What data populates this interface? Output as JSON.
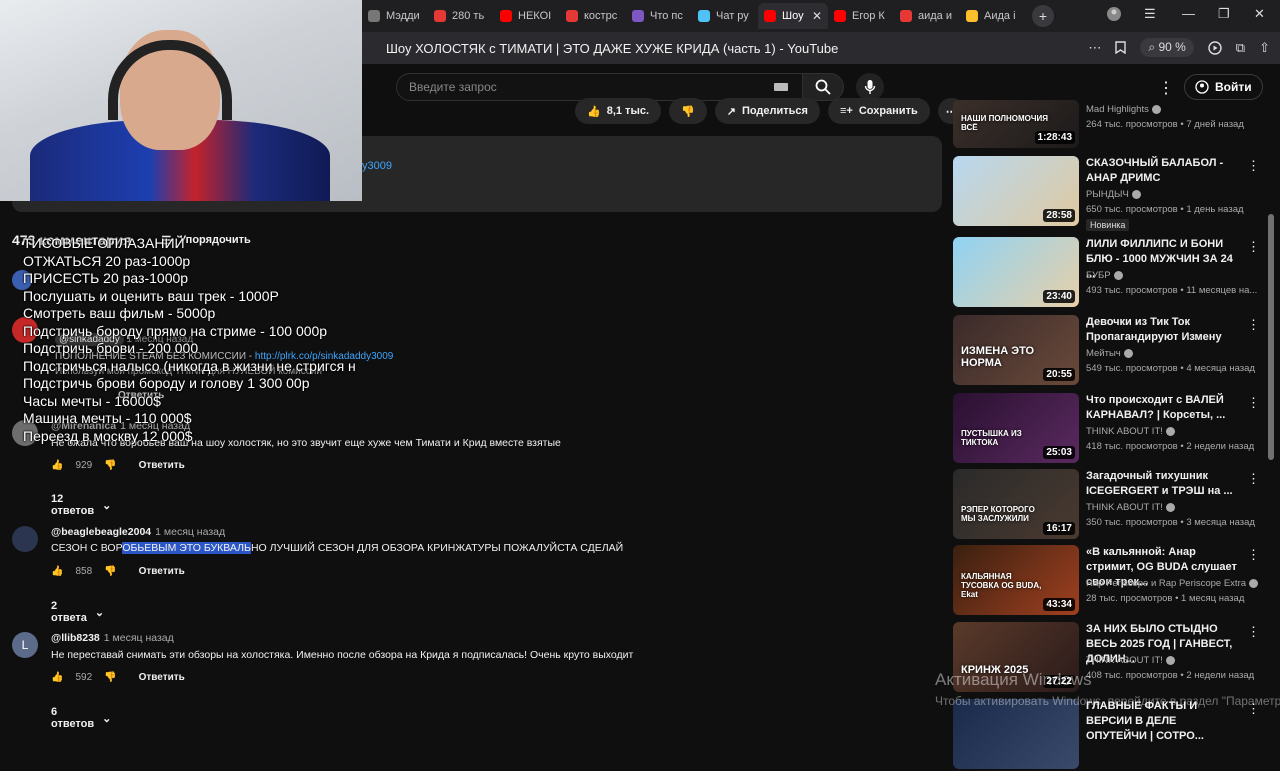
{
  "browser": {
    "tabs": [
      {
        "label": "Мэдди",
        "color": "#777777"
      },
      {
        "label": "280 ть",
        "color": "#e53935"
      },
      {
        "label": "НЕКОІ",
        "color": "#ff0000"
      },
      {
        "label": "кострс",
        "color": "#e53935"
      },
      {
        "label": "Что пс",
        "color": "#7e57c2"
      },
      {
        "label": "Чат ру",
        "color": "#4fc3f7"
      },
      {
        "label": "Шоу",
        "color": "#ff0000",
        "active": true
      },
      {
        "label": "Егор К",
        "color": "#ff0000"
      },
      {
        "label": "аида и",
        "color": "#e53935"
      },
      {
        "label": "Аида і",
        "color": "#fbc02d"
      }
    ],
    "page_title": "Шоу ХОЛОСТЯК с ТИМАТИ | ЭТО ДАЖЕ ХУЖЕ КРИДА (часть 1) - YouTube",
    "zoom": "90 %",
    "new_tab": "+"
  },
  "header": {
    "search_placeholder": "Введите запрос",
    "signin_label": "Войти"
  },
  "actions": {
    "likes": "8,1 тыс.",
    "share": "Поделиться",
    "save": "Сохранить"
  },
  "description": {
    "link": "y3009"
  },
  "comments": {
    "count": "473 комментария",
    "sort_label": "Упорядочить",
    "reply_label": "Ответить",
    "items": [
      {
        "author": "@Mirenanica",
        "time": "1 месяц назад",
        "text": "Не ожала что воробьев ваш на шоу холостяк, но это звучит еще хуже чем Тимати и Крид вместе взятые",
        "likes": "929",
        "replies": "12 ответов"
      },
      {
        "author": "@beaglebeagle2004",
        "time": "1 месяц назад",
        "text_before": "СЕЗОН С ВОР",
        "text_highlight": "ОБЬЕВЫМ ЭТО БУКВАЛЬ",
        "text_after": "НО ЛУЧШИЙ СЕЗОН ДЛЯ ОБЗОРА КРИНЖАТУРЫ ПОЖАЛУЙСТА СДЕЛАЙ",
        "likes": "858",
        "replies": "2 ответа"
      },
      {
        "author": "@llib8238",
        "time": "1 месяц назад",
        "avatar_letter": "L",
        "text": "Не переставай снимать эти обзоры на холостяка. Именно после обзора на Крида я подписалась! Очень круто выходит",
        "likes": "592",
        "replies": "6 ответов"
      }
    ],
    "pinned": {
      "author": "@sinkadaddy",
      "time": "1 месяц назад",
      "line1": "ПОПОЛНЕНИЕ STEAM БЕЗ КОМИССИИ -",
      "link": "http://plrk.co/p/sinkadaddy3009",
      "line2": "Используй мой промокод THINK для НУЛЕВОЙ комиссии",
      "reply": "Ответить"
    }
  },
  "overlay": {
    "lines": [
      "ТИСОВЫЕ ОПЛАЗАНИЙ",
      "ОТЖАТЬСЯ 20 раз-1000р",
      "ПРИСЕСТЬ 20 раз-1000р",
      "Послушать и оценить ваш трек - 1000Р",
      "Смотреть ваш фильм - 5000р",
      "Подстричь бороду прямо на стриме - 100 000р",
      "Подстричь брови - 200 000",
      "Подстричься налысо (никогда в жизни не стригся н",
      "Подстричь брови бороду и голову 1 300 00р",
      "Часы мечты - 16000$",
      "Машина мечты - 110 000$",
      "Переезд в москву 12 000$"
    ]
  },
  "sidebar": {
    "videos": [
      {
        "title": "",
        "channel": "Mad Highlights",
        "meta": "264 тыс. просмотров • 7 дней назад",
        "duration": "1:28:43",
        "thumb_text": "НАШИ ПОЛНОМОЧИЯ ВСЁ",
        "colors": [
          "#3b2f2a",
          "#1c1a1a"
        ]
      },
      {
        "title": "СКАЗОЧНЫЙ БАЛАБОЛ - АНАР ДРИМС",
        "channel": "РЫНДЫЧ",
        "meta": "650 тыс. просмотров • 1 день назад",
        "badge": "Новинка",
        "duration": "28:58",
        "thumb_text": "",
        "colors": [
          "#b7d8f0",
          "#e0c9a0"
        ]
      },
      {
        "title": "ЛИЛИ ФИЛЛИПС И БОНИ БЛЮ - 1000 МУЖЧИН ЗА 24 ...",
        "channel": "БУБР",
        "meta": "493 тыс. просмотров • 11 месяцев на...",
        "duration": "23:40",
        "thumb_text": "",
        "colors": [
          "#8fd3f4",
          "#e8cfa8"
        ]
      },
      {
        "title": "Девочки из Тик Ток Пропагандируют Измену",
        "channel": "Мейтыч",
        "meta": "549 тыс. просмотров • 4 месяца назад",
        "duration": "20:55",
        "thumb_text": "ИЗМЕНА ЭТО НОРМА",
        "colors": [
          "#3a2a2a",
          "#6a4a3a"
        ]
      },
      {
        "title": "Что происходит с ВАЛЕЙ КАРНАВАЛ? | Корсеты, ...",
        "channel": "THINK ABOUT IT!",
        "meta": "418 тыс. просмотров • 2 недели назад",
        "duration": "25:03",
        "thumb_text": "ПУСТЫШКА ИЗ ТИКТОКА",
        "colors": [
          "#2a1030",
          "#5a2a60"
        ]
      },
      {
        "title": "Загадочный тихушник ICEGERGERT и ТРЭШ на ...",
        "channel": "THINK ABOUT IT!",
        "meta": "350 тыс. просмотров • 3 месяца назад",
        "duration": "16:17",
        "thumb_text": "РЭПЕР КОТОРОГО МЫ ЗАСЛУЖИЛИ",
        "colors": [
          "#2a2a2a",
          "#4a3a30"
        ]
      },
      {
        "title": "«В кальянной: Анар стримит, OG BUDA слушает свои трек...",
        "channel": "Rap Periscope и Rap Periscope Extra",
        "meta": "28 тыс. просмотров • 1 месяц назад",
        "duration": "43:34",
        "thumb_text": "КАЛЬЯННАЯ ТУСОВКА OG BUDA, Ekat",
        "colors": [
          "#3a2010",
          "#a04020"
        ]
      },
      {
        "title": "ЗА НИХ БЫЛО СТЫДНО ВЕСЬ 2025 ГОД | ГАНВЕСТ, ДОЛИН...",
        "channel": "THINK ABOUT IT!",
        "meta": "408 тыс. просмотров • 2 недели назад",
        "duration": "27:22",
        "thumb_text": "КРИНЖ 2025",
        "colors": [
          "#5a3a2a",
          "#2a1a1a"
        ]
      },
      {
        "title": "ГЛАВНЫЕ ФАКТЫ И ВЕРСИИ В ДЕЛЕ ОПУТЕЙЧИ | СОТРО...",
        "channel": "",
        "meta": "",
        "duration": "",
        "thumb_text": "",
        "colors": [
          "#1a2a4a",
          "#3a4a6a"
        ]
      }
    ]
  },
  "watermark": {
    "title": "Активация Windows",
    "subtitle": "Чтобы активировать Windows, перейдите в раздел \"Параметры\"."
  }
}
